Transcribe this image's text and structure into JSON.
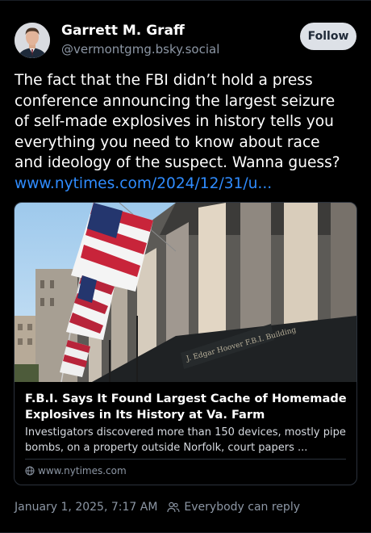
{
  "post": {
    "author": {
      "name": "Garrett M. Graff",
      "handle": "@vermontgmg.bsky.social"
    },
    "follow_label": "Follow",
    "text_lines": [
      "The fact that the FBI didn’t hold a press",
      "conference announcing the largest seizure",
      "of self-made explosives in history tells you",
      "everything you need to know about race",
      "and ideology of the suspect. Wanna guess?"
    ],
    "link_text": "www.nytimes.com/2024/12/31/u...",
    "link_preview": {
      "title": "F.B.I. Says It Found Largest Cache of Homemade Explosives in Its History at Va. Farm",
      "description": "Investigators discovered more than 150 devices, mostly pipe bombs, on a property outside Norfolk, court papers ...",
      "domain": "www.nytimes.com",
      "image_sign_text": "J. Edgar Hoover F.B.I. Building"
    },
    "timestamp": "January 1, 2025, 7:17 AM",
    "reply_setting": "Everybody can reply"
  },
  "colors": {
    "background": "#000000",
    "link": "#2f8cff",
    "muted": "#8c96a4",
    "follow_button": "#dde1e7"
  },
  "icons": [
    "avatar-photo",
    "globe-icon",
    "people-icon"
  ]
}
